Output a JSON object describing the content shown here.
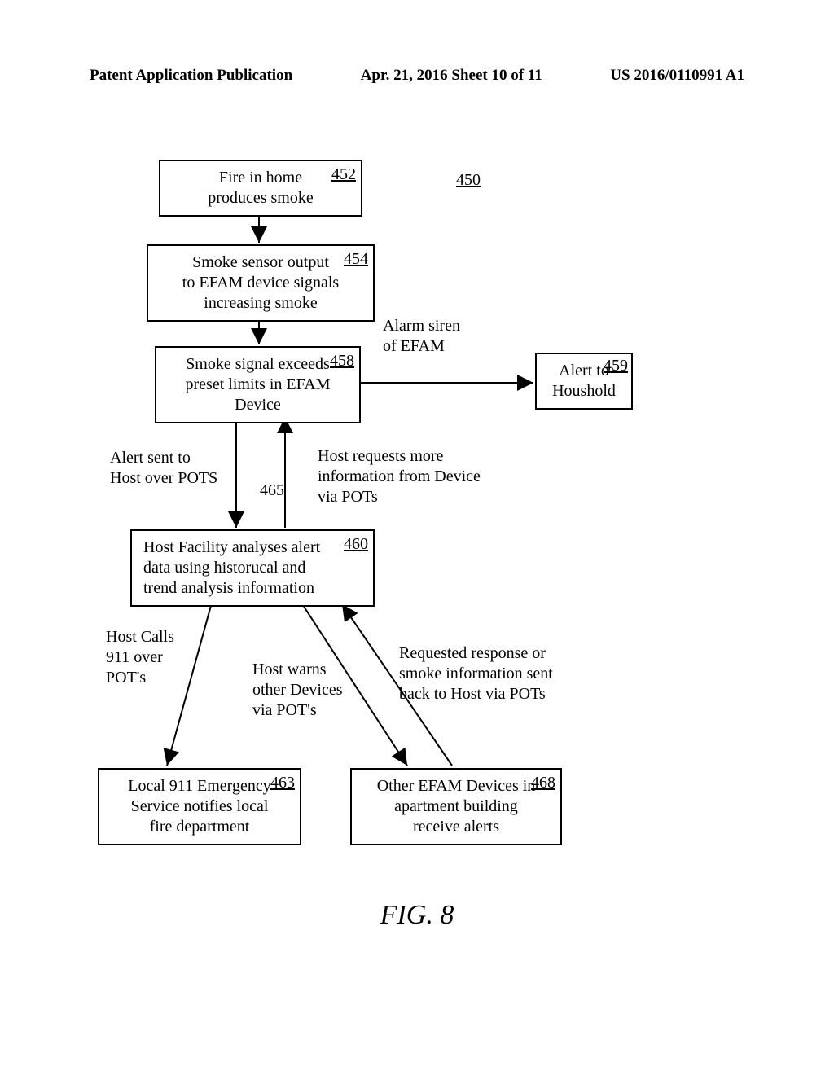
{
  "header": {
    "left": "Patent Application Publication",
    "center": "Apr. 21, 2016  Sheet 10 of 11",
    "right": "US 2016/0110991 A1"
  },
  "refs": {
    "r450": "450",
    "r452": "452",
    "r454": "454",
    "r458": "458",
    "r459": "459",
    "r460": "460",
    "r463": "463",
    "r465": "465",
    "r468": "468"
  },
  "boxes": {
    "b452": "Fire in home\nproduces smoke",
    "b454": "Smoke sensor output\nto EFAM device signals\nincreasing smoke",
    "b458": "Smoke signal exceeds\npreset limits in EFAM\nDevice",
    "b459": "Alert to\nHoushold",
    "b460": "Host Facility analyses alert\ndata using historucal and\ntrend analysis information",
    "b463": "Local 911 Emergency\nService notifies local\nfire department",
    "b468": "Other EFAM Devices in\napartment building\nreceive alerts"
  },
  "labels": {
    "alarm": "Alarm siren\nof EFAM",
    "alertHost": "Alert sent to\nHost over POTS",
    "hostReq": "Host requests more\ninformation from Device\nvia POTs",
    "hostCalls911": "Host Calls\n911 over\nPOT's",
    "hostWarns": "Host warns\nother Devices\nvia POT's",
    "reqResp": "Requested response or\nsmoke information sent\nback to Host via POTs"
  },
  "figure": "FIG. 8",
  "chart_data": {
    "type": "diagram-flow",
    "title": "FIG. 8",
    "nodes": [
      {
        "id": "452",
        "label": "Fire in home produces smoke"
      },
      {
        "id": "454",
        "label": "Smoke sensor output to EFAM device signals increasing smoke"
      },
      {
        "id": "458",
        "label": "Smoke signal exceeds preset limits in EFAM Device"
      },
      {
        "id": "459",
        "label": "Alert to Houshold"
      },
      {
        "id": "460",
        "label": "Host Facility analyses alert data using historucal and trend analysis information"
      },
      {
        "id": "463",
        "label": "Local 911 Emergency Service notifies local fire department"
      },
      {
        "id": "468",
        "label": "Other EFAM Devices in apartment building receive alerts"
      }
    ],
    "edges": [
      {
        "from": "452",
        "to": "454",
        "label": ""
      },
      {
        "from": "454",
        "to": "458",
        "label": ""
      },
      {
        "from": "458",
        "to": "459",
        "label": "Alarm siren of EFAM"
      },
      {
        "from": "458",
        "to": "460",
        "label": "Alert sent to Host over POTS"
      },
      {
        "from": "460",
        "to": "458",
        "label": "Host requests more information from Device via POTs",
        "ref": "465"
      },
      {
        "from": "460",
        "to": "463",
        "label": "Host Calls 911 over POT's"
      },
      {
        "from": "460",
        "to": "468",
        "label": "Host warns other Devices via POT's"
      },
      {
        "from": "468",
        "to": "460",
        "label": "Requested response or smoke information sent back to Host via POTs"
      }
    ],
    "free_refs": [
      "450"
    ]
  }
}
